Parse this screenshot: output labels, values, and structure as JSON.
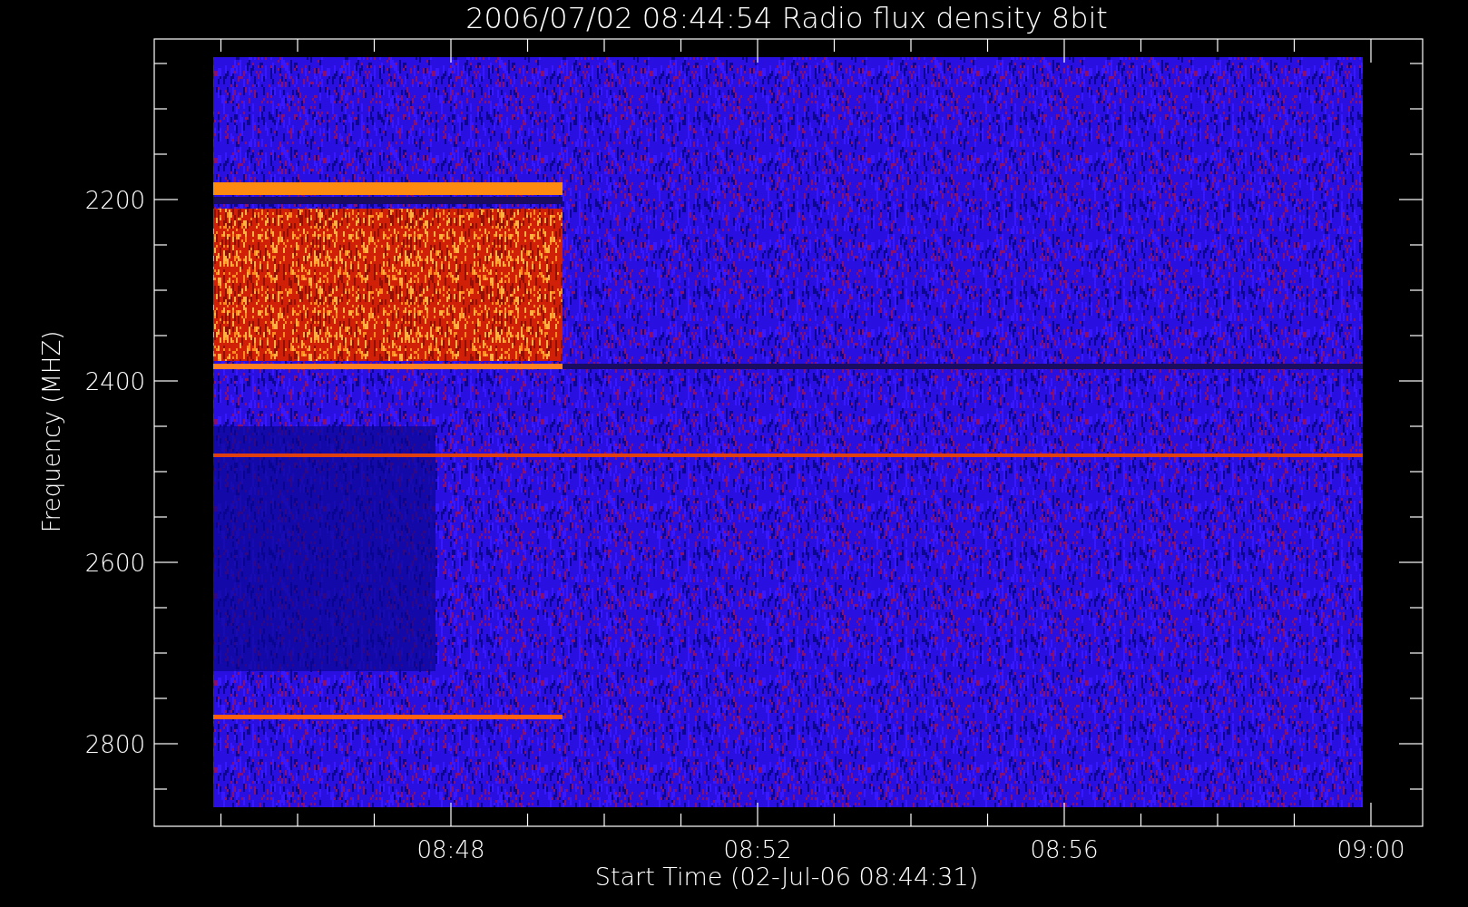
{
  "title": "2006/07/02 08:44:54 Radio flux density 8bit",
  "plot": {
    "xlabel": "Start Time (02-Jul-06 08:44:31)",
    "ylabel": "Frequency (MHZ)",
    "xticks": [
      "08:48",
      "08:52",
      "08:56",
      "09:00"
    ],
    "yticks": [
      "2200",
      "2400",
      "2600",
      "2800"
    ]
  }
}
